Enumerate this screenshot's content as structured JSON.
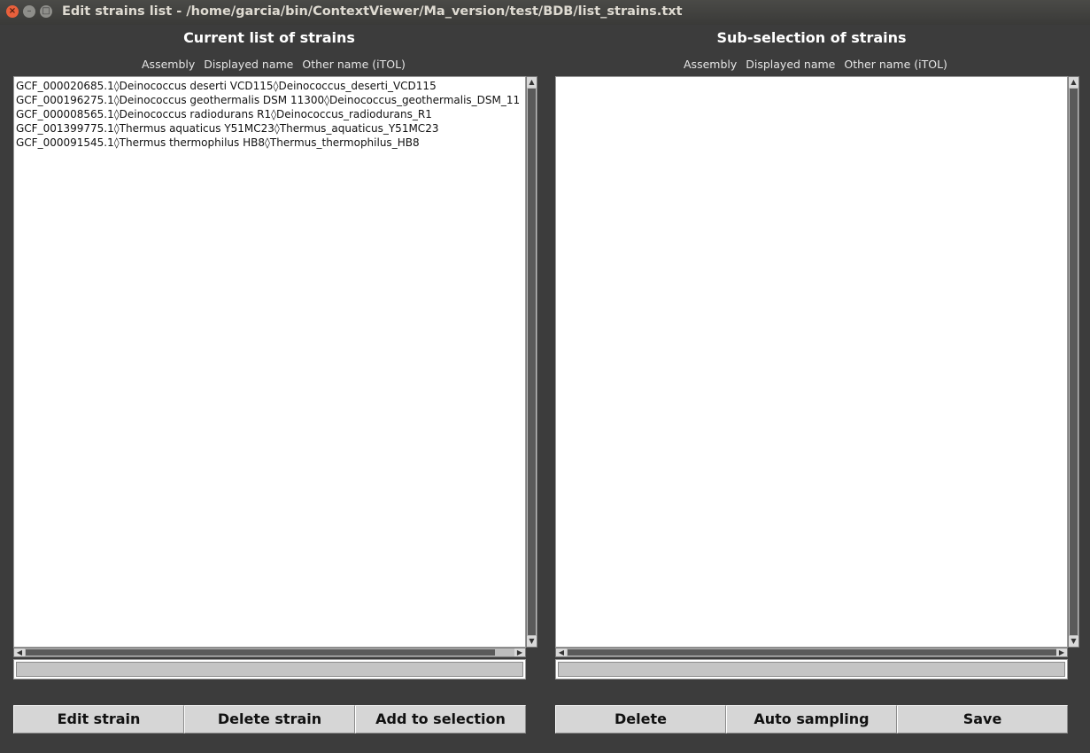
{
  "window": {
    "title": "Edit strains list - /home/garcia/bin/ContextViewer/Ma_version/test/BDB/list_strains.txt",
    "close_glyph": "×",
    "min_glyph": "–",
    "max_glyph": "□"
  },
  "left": {
    "title": "Current list of strains",
    "columns": [
      "Assembly",
      "Displayed name",
      "Other name (iTOL)"
    ],
    "rows": [
      "GCF_000020685.1◊Deinococcus deserti VCD115◊Deinococcus_deserti_VCD115",
      "GCF_000196275.1◊Deinococcus geothermalis DSM 11300◊Deinococcus_geothermalis_DSM_11",
      "GCF_000008565.1◊Deinococcus radiodurans R1◊Deinococcus_radiodurans_R1",
      "GCF_001399775.1◊Thermus aquaticus Y51MC23◊Thermus_aquaticus_Y51MC23",
      "GCF_000091545.1◊Thermus thermophilus HB8◊Thermus_thermophilus_HB8"
    ],
    "entry_value": "",
    "buttons": {
      "edit": "Edit strain",
      "delete": "Delete strain",
      "add": "Add to selection"
    }
  },
  "right": {
    "title": "Sub-selection of strains",
    "columns": [
      "Assembly",
      "Displayed name",
      "Other name (iTOL)"
    ],
    "rows": [],
    "entry_value": "",
    "buttons": {
      "delete": "Delete",
      "auto": "Auto sampling",
      "save": "Save"
    }
  },
  "scroll_glyphs": {
    "up": "▲",
    "down": "▼",
    "left": "◀",
    "right": "▶"
  },
  "colors": {
    "background": "#3c3c3c",
    "close_button": "#e8603c",
    "button_face": "#d6d6d6",
    "entry_fill": "#c4c4c4"
  }
}
